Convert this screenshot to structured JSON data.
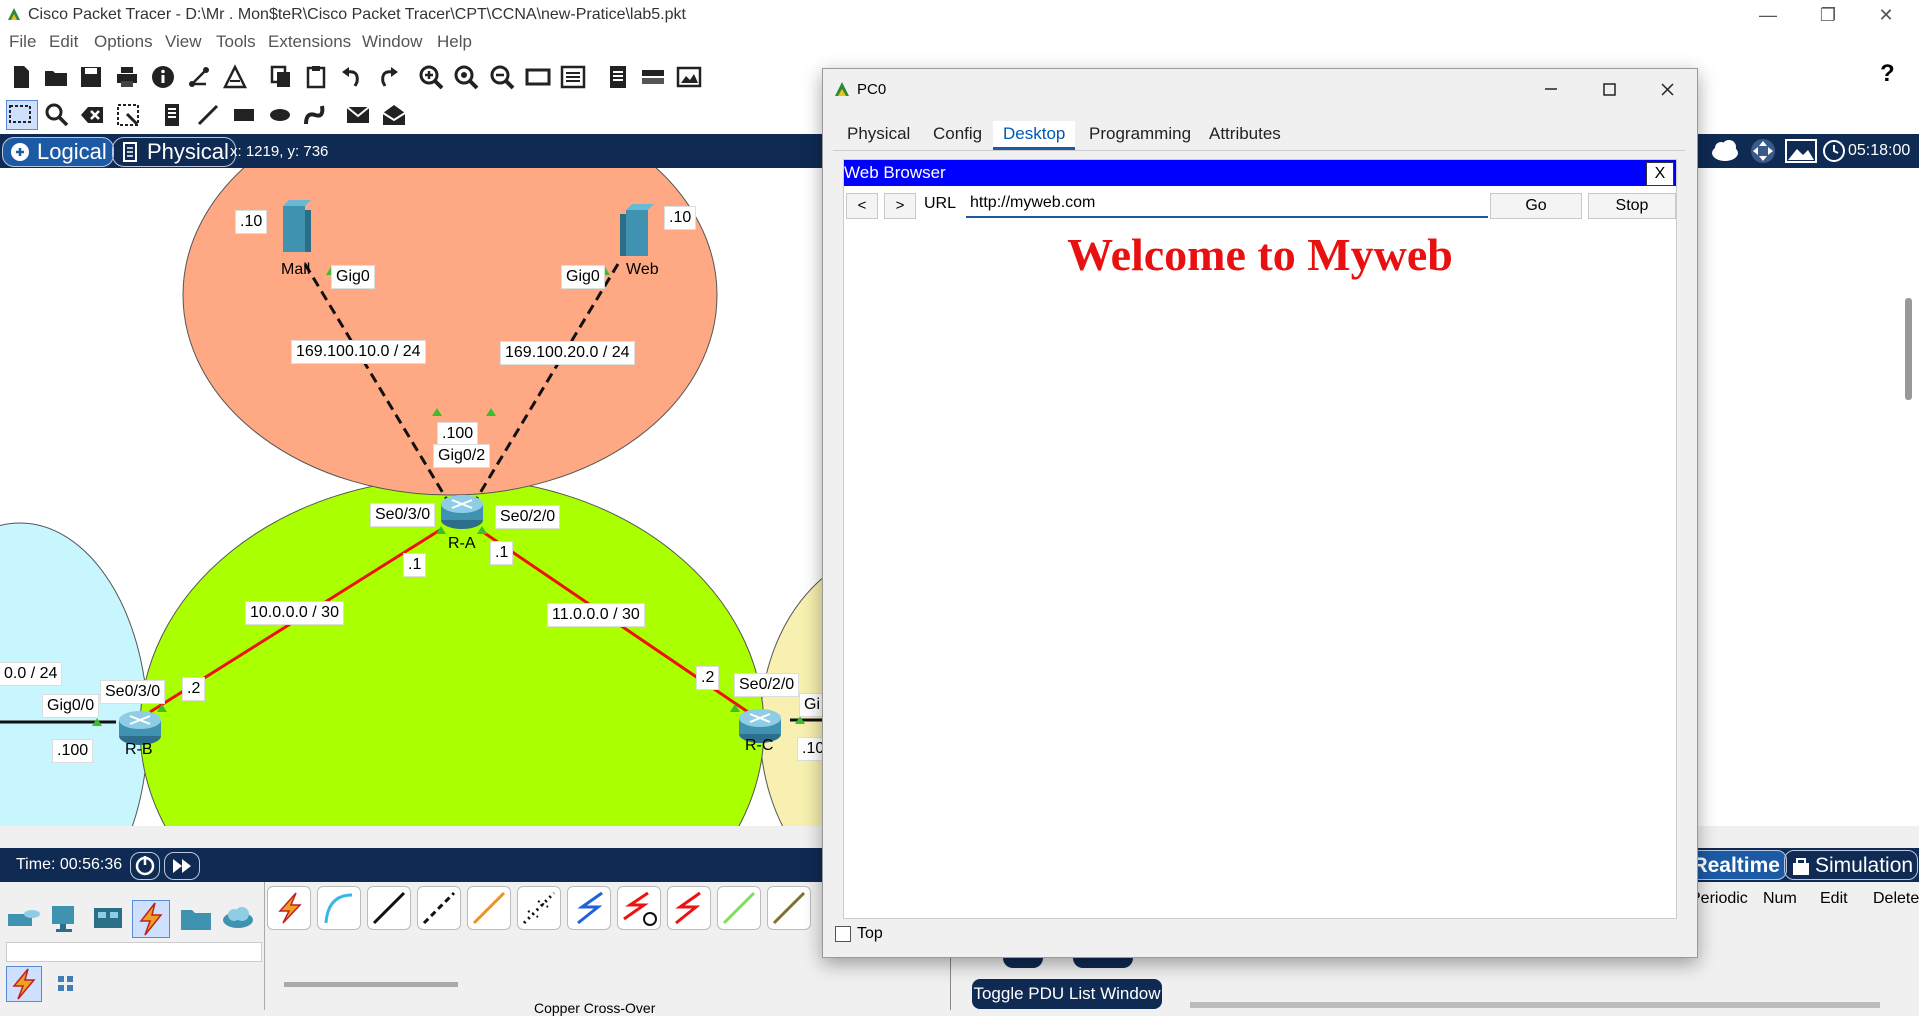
{
  "window": {
    "title": "Cisco Packet Tracer - D:\\Mr . Mon$teR\\Cisco Packet Tracer\\CPT\\CCNA\\new-Pratice\\lab5.pkt",
    "minimize": "—",
    "restore": "❐",
    "close": "✕"
  },
  "menu": [
    "File",
    "Edit",
    "Options",
    "View",
    "Tools",
    "Extensions",
    "Window",
    "Help"
  ],
  "help_icon": "?",
  "viewbar": {
    "logical": "Logical",
    "physical": "Physical",
    "coords": "x: 1219, y: 736",
    "clock": "05:18:00"
  },
  "topology": {
    "colors": {
      "orange_area": "#ffa984",
      "green_area": "#aaff00",
      "blue_area": "#c8f6ff",
      "yellow_area": "#f7f0b0",
      "serial_link": "#ee1111"
    },
    "mail": {
      "name": "Mail",
      "ip": ".10",
      "port": "Gig0"
    },
    "web": {
      "name": "Web",
      "ip": ".10",
      "port": "Gig0"
    },
    "net1": "169.100.10.0 / 24",
    "net2": "169.100.20.0 / 24",
    "ra": {
      "name": "R-A",
      "ip": ".100",
      "port_g": "Gig0/2",
      "port_s3": "Se0/3/0",
      "port_s2": "Se0/2/0",
      "ip_left": ".1",
      "ip_right": ".1"
    },
    "net_ab": "10.0.0.0 / 30",
    "net_ac": "11.0.0.0 / 30",
    "rb": {
      "name": "R-B",
      "lan": "0.0 / 24",
      "port_g": "Gig0/0",
      "port_s": "Se0/3/0",
      "ip_s": ".2",
      "ip_g": ".100"
    },
    "rc": {
      "name": "R-C",
      "port_s": "Se0/2/0",
      "ip_s": ".2",
      "port_g": "Gi",
      "ip_g": ".10"
    }
  },
  "bottom": {
    "time": "Time: 00:56:36",
    "realtime": "Realtime",
    "simulation": "Simulation",
    "pdu_headers": [
      "Periodic",
      "Num",
      "Edit",
      "Delete"
    ],
    "toggle_pdu": "Toggle PDU List Window",
    "cable_label": "Copper Cross-Over"
  },
  "pc0": {
    "title": "PC0",
    "tabs": [
      "Physical",
      "Config",
      "Desktop",
      "Programming",
      "Attributes"
    ],
    "active_tab": "Desktop",
    "browser": {
      "title": "Web Browser",
      "close": "X",
      "back": "<",
      "forward": ">",
      "url_label": "URL",
      "url": "http://myweb.com",
      "go": "Go",
      "stop": "Stop",
      "heading": "Welcome to Myweb"
    },
    "top_label": "Top"
  }
}
